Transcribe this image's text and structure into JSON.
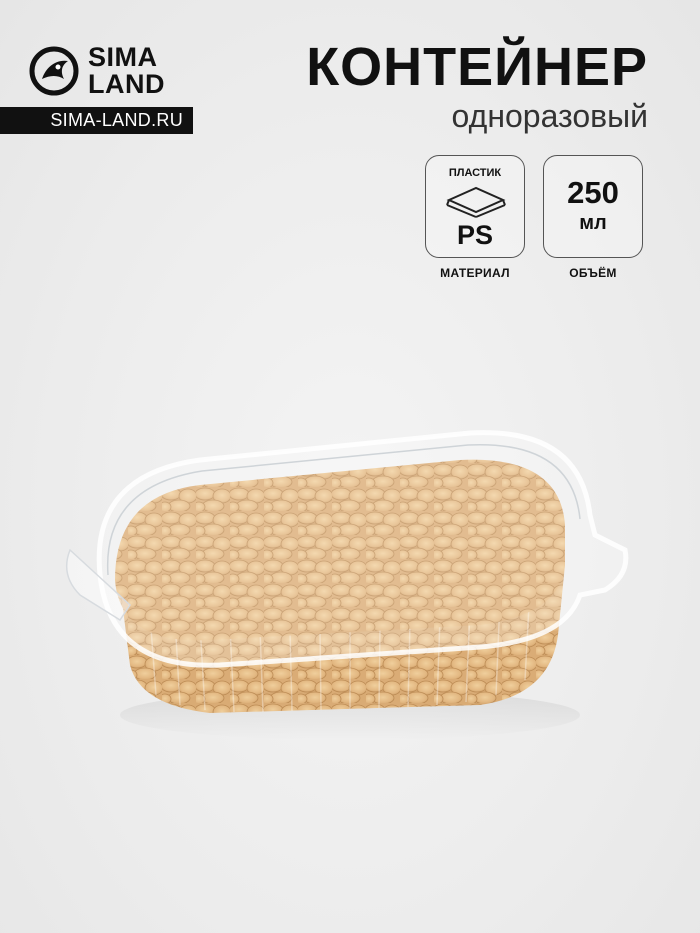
{
  "logo": {
    "line1": "SIMA",
    "line2": "LAND",
    "url": "SIMA-LAND.RU",
    "icon": "lion-icon"
  },
  "title": {
    "main": "КОНТЕЙНЕР",
    "sub": "одноразовый"
  },
  "material": {
    "top_label": "ПЛАСТИК",
    "code": "PS",
    "caption": "МАТЕРИАЛ",
    "icon": "plastic-layers-icon"
  },
  "volume": {
    "value": "250",
    "unit": "мл",
    "caption": "ОБЪЁМ"
  },
  "product": {
    "image": "container-with-peanuts"
  },
  "colors": {
    "text": "#111111",
    "background": "#ececec",
    "peanut": "#e3b77c"
  }
}
